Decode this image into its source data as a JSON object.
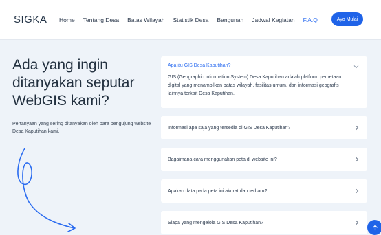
{
  "brand": "SIGKA",
  "nav": {
    "items": [
      {
        "label": "Home",
        "active": false
      },
      {
        "label": "Tentang Desa",
        "active": false
      },
      {
        "label": "Batas Wilayah",
        "active": false
      },
      {
        "label": "Statistik Desa",
        "active": false
      },
      {
        "label": "Bangunan",
        "active": false
      },
      {
        "label": "Jadwal Kegiatan",
        "active": false
      },
      {
        "label": "F.A.Q",
        "active": true
      }
    ],
    "cta_label": "Ayo Mulai"
  },
  "hero": {
    "title": "Ada yang ingin ditanyakan seputar WebGIS kami?",
    "description": "Pertanyaan yang sering ditanyakan oleh para pengujung website Desa Kaputihan kami."
  },
  "faq": {
    "items": [
      {
        "question": "Apa itu GIS Desa Kaputihan?",
        "answer": "GIS (Geographic Information System) Desa Kaputihan adalah platform pemetaan digital yang menampilkan batas wilayah, fasilitas umum, dan informasi geografis lainnya terkait Desa Kaputihan.",
        "expanded": true
      },
      {
        "question": "Informasi apa saja yang tersedia di GIS Desa Kaputihan?",
        "expanded": false
      },
      {
        "question": "Bagaimana cara menggunakan peta di website ini?",
        "expanded": false
      },
      {
        "question": "Apakah data pada peta ini akurat dan terbaru?",
        "expanded": false
      },
      {
        "question": "Siapa yang mengelola GIS Desa Kaputihan?",
        "expanded": false
      }
    ]
  },
  "colors": {
    "accent": "#1f63e8",
    "active_link": "#2b6cf0",
    "background": "#eef3f9",
    "card": "#ffffff"
  },
  "icons": {
    "chevron_open": "chevron-down-icon",
    "chevron_closed": "chevron-right-icon",
    "scroll_top": "arrow-up-icon",
    "decoration": "curved-arrow-icon"
  }
}
